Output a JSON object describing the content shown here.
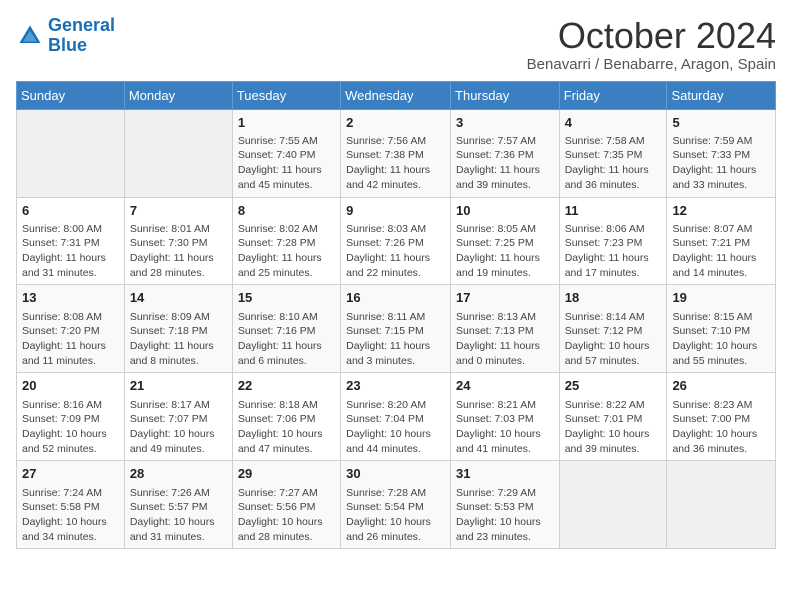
{
  "logo": {
    "line1": "General",
    "line2": "Blue"
  },
  "title": "October 2024",
  "subtitle": "Benavarri / Benabarre, Aragon, Spain",
  "headers": [
    "Sunday",
    "Monday",
    "Tuesday",
    "Wednesday",
    "Thursday",
    "Friday",
    "Saturday"
  ],
  "weeks": [
    [
      {
        "day": "",
        "content": ""
      },
      {
        "day": "",
        "content": ""
      },
      {
        "day": "1",
        "content": "Sunrise: 7:55 AM\nSunset: 7:40 PM\nDaylight: 11 hours and 45 minutes."
      },
      {
        "day": "2",
        "content": "Sunrise: 7:56 AM\nSunset: 7:38 PM\nDaylight: 11 hours and 42 minutes."
      },
      {
        "day": "3",
        "content": "Sunrise: 7:57 AM\nSunset: 7:36 PM\nDaylight: 11 hours and 39 minutes."
      },
      {
        "day": "4",
        "content": "Sunrise: 7:58 AM\nSunset: 7:35 PM\nDaylight: 11 hours and 36 minutes."
      },
      {
        "day": "5",
        "content": "Sunrise: 7:59 AM\nSunset: 7:33 PM\nDaylight: 11 hours and 33 minutes."
      }
    ],
    [
      {
        "day": "6",
        "content": "Sunrise: 8:00 AM\nSunset: 7:31 PM\nDaylight: 11 hours and 31 minutes."
      },
      {
        "day": "7",
        "content": "Sunrise: 8:01 AM\nSunset: 7:30 PM\nDaylight: 11 hours and 28 minutes."
      },
      {
        "day": "8",
        "content": "Sunrise: 8:02 AM\nSunset: 7:28 PM\nDaylight: 11 hours and 25 minutes."
      },
      {
        "day": "9",
        "content": "Sunrise: 8:03 AM\nSunset: 7:26 PM\nDaylight: 11 hours and 22 minutes."
      },
      {
        "day": "10",
        "content": "Sunrise: 8:05 AM\nSunset: 7:25 PM\nDaylight: 11 hours and 19 minutes."
      },
      {
        "day": "11",
        "content": "Sunrise: 8:06 AM\nSunset: 7:23 PM\nDaylight: 11 hours and 17 minutes."
      },
      {
        "day": "12",
        "content": "Sunrise: 8:07 AM\nSunset: 7:21 PM\nDaylight: 11 hours and 14 minutes."
      }
    ],
    [
      {
        "day": "13",
        "content": "Sunrise: 8:08 AM\nSunset: 7:20 PM\nDaylight: 11 hours and 11 minutes."
      },
      {
        "day": "14",
        "content": "Sunrise: 8:09 AM\nSunset: 7:18 PM\nDaylight: 11 hours and 8 minutes."
      },
      {
        "day": "15",
        "content": "Sunrise: 8:10 AM\nSunset: 7:16 PM\nDaylight: 11 hours and 6 minutes."
      },
      {
        "day": "16",
        "content": "Sunrise: 8:11 AM\nSunset: 7:15 PM\nDaylight: 11 hours and 3 minutes."
      },
      {
        "day": "17",
        "content": "Sunrise: 8:13 AM\nSunset: 7:13 PM\nDaylight: 11 hours and 0 minutes."
      },
      {
        "day": "18",
        "content": "Sunrise: 8:14 AM\nSunset: 7:12 PM\nDaylight: 10 hours and 57 minutes."
      },
      {
        "day": "19",
        "content": "Sunrise: 8:15 AM\nSunset: 7:10 PM\nDaylight: 10 hours and 55 minutes."
      }
    ],
    [
      {
        "day": "20",
        "content": "Sunrise: 8:16 AM\nSunset: 7:09 PM\nDaylight: 10 hours and 52 minutes."
      },
      {
        "day": "21",
        "content": "Sunrise: 8:17 AM\nSunset: 7:07 PM\nDaylight: 10 hours and 49 minutes."
      },
      {
        "day": "22",
        "content": "Sunrise: 8:18 AM\nSunset: 7:06 PM\nDaylight: 10 hours and 47 minutes."
      },
      {
        "day": "23",
        "content": "Sunrise: 8:20 AM\nSunset: 7:04 PM\nDaylight: 10 hours and 44 minutes."
      },
      {
        "day": "24",
        "content": "Sunrise: 8:21 AM\nSunset: 7:03 PM\nDaylight: 10 hours and 41 minutes."
      },
      {
        "day": "25",
        "content": "Sunrise: 8:22 AM\nSunset: 7:01 PM\nDaylight: 10 hours and 39 minutes."
      },
      {
        "day": "26",
        "content": "Sunrise: 8:23 AM\nSunset: 7:00 PM\nDaylight: 10 hours and 36 minutes."
      }
    ],
    [
      {
        "day": "27",
        "content": "Sunrise: 7:24 AM\nSunset: 5:58 PM\nDaylight: 10 hours and 34 minutes."
      },
      {
        "day": "28",
        "content": "Sunrise: 7:26 AM\nSunset: 5:57 PM\nDaylight: 10 hours and 31 minutes."
      },
      {
        "day": "29",
        "content": "Sunrise: 7:27 AM\nSunset: 5:56 PM\nDaylight: 10 hours and 28 minutes."
      },
      {
        "day": "30",
        "content": "Sunrise: 7:28 AM\nSunset: 5:54 PM\nDaylight: 10 hours and 26 minutes."
      },
      {
        "day": "31",
        "content": "Sunrise: 7:29 AM\nSunset: 5:53 PM\nDaylight: 10 hours and 23 minutes."
      },
      {
        "day": "",
        "content": ""
      },
      {
        "day": "",
        "content": ""
      }
    ]
  ]
}
